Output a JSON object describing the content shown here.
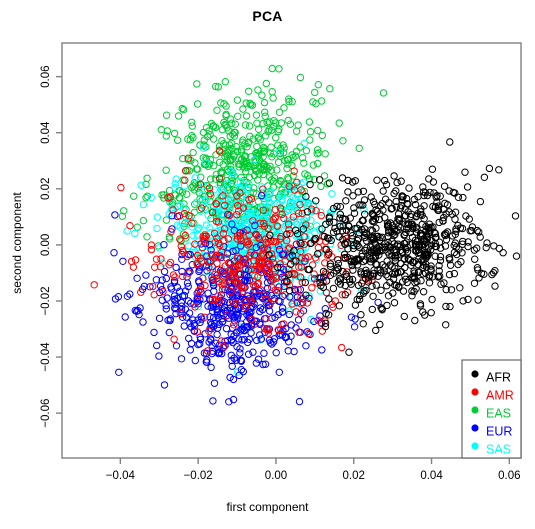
{
  "chart_data": {
    "type": "scatter",
    "title": "PCA",
    "xlabel": "first component",
    "ylabel": "second component",
    "xlim": [
      -0.055,
      0.063
    ],
    "ylim": [
      -0.076,
      0.072
    ],
    "xticks": [
      "-0.04",
      "-0.02",
      "0.00",
      "0.02",
      "0.04",
      "0.06"
    ],
    "xtick_values": [
      -0.04,
      -0.02,
      0.0,
      0.02,
      0.04,
      0.06
    ],
    "yticks": [
      "-0.06",
      "-0.04",
      "-0.02",
      "0.00",
      "0.02",
      "0.04",
      "0.06"
    ],
    "ytick_values": [
      -0.06,
      -0.04,
      -0.02,
      0.0,
      0.02,
      0.04,
      0.06
    ],
    "grid": false,
    "marker": "open-circle",
    "marker_radius_px": 3.2,
    "legend_position": "bottom-right",
    "series": [
      {
        "name": "AFR",
        "color": "#000000",
        "n": 660,
        "center": [
          0.0305,
          0.0005
        ],
        "spread": [
          0.0115,
          0.0115
        ],
        "seed": 101
      },
      {
        "name": "AMR",
        "color": "#FF0000",
        "n": 350,
        "center": [
          -0.0065,
          -0.0055
        ],
        "spread": [
          0.0125,
          0.0135
        ],
        "seed": 202
      },
      {
        "name": "EAS",
        "color": "#00CC33",
        "n": 500,
        "center": [
          -0.0095,
          0.0275
        ],
        "spread": [
          0.0105,
          0.0135
        ],
        "seed": 303
      },
      {
        "name": "EUR",
        "color": "#0000FF",
        "n": 500,
        "center": [
          -0.0125,
          -0.0225
        ],
        "spread": [
          0.0115,
          0.0115
        ],
        "seed": 404
      },
      {
        "name": "SAS",
        "color": "#00FFFF",
        "n": 480,
        "center": [
          -0.0055,
          0.0035
        ],
        "spread": [
          0.0105,
          0.0105
        ],
        "seed": 505
      }
    ]
  },
  "legend": {
    "items": [
      {
        "label": "AFR",
        "color": "#000000"
      },
      {
        "label": "AMR",
        "color": "#FF0000"
      },
      {
        "label": "EAS",
        "color": "#00CC33"
      },
      {
        "label": "EUR",
        "color": "#0000FF"
      },
      {
        "label": "SAS",
        "color": "#00FFFF"
      }
    ]
  },
  "axes": {
    "frame_color": "#808080",
    "tick_color": "#808080"
  }
}
